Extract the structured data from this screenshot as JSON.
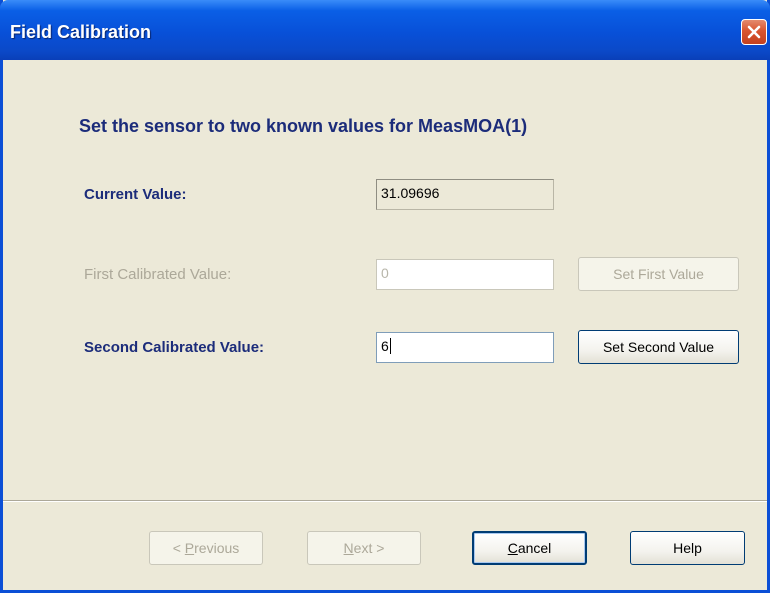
{
  "window": {
    "title": "Field Calibration"
  },
  "main": {
    "heading": "Set the sensor to two known values for MeasMOA(1)",
    "current": {
      "label": "Current Value:",
      "value": "31.09696"
    },
    "first": {
      "label": "First Calibrated Value:",
      "value": "0",
      "button": "Set First Value"
    },
    "second": {
      "label": "Second Calibrated Value:",
      "value": "6",
      "button": "Set Second Value"
    }
  },
  "footer": {
    "previous": {
      "accel": "P",
      "rest": "revious",
      "prefix": "< "
    },
    "next": {
      "accel": "N",
      "rest": "ext",
      "suffix": " >"
    },
    "cancel": {
      "accel": "C",
      "rest": "ancel"
    },
    "help": "Help"
  },
  "icons": {
    "close": "close-icon"
  },
  "colors": {
    "title_bar": "#0850d8",
    "dialog_bg": "#ece9d8",
    "label_text": "#1c2c7a",
    "disabled_text": "#aca899",
    "close_button": "#d9552f"
  }
}
